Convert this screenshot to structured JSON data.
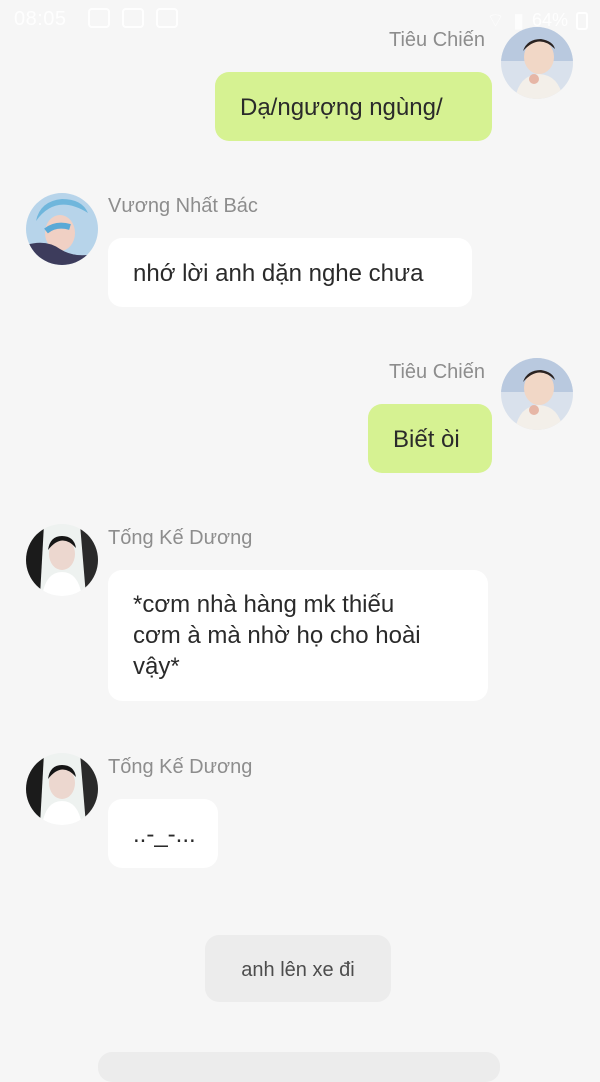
{
  "status_bar": {
    "time": "08:05",
    "battery": "64%"
  },
  "messages": [
    {
      "side": "right",
      "sender": "Tiêu Chiến",
      "text": "Dạ/ngượng ngùng/",
      "bubble_color": "#d6f292",
      "avatar": "avatar-tieu-chien"
    },
    {
      "side": "left",
      "sender": "Vương Nhất Bác",
      "text": "nhớ lời anh dặn nghe chưa",
      "bubble_color": "#ffffff",
      "avatar": "avatar-vuong-nhat-bac"
    },
    {
      "side": "right",
      "sender": "Tiêu Chiến",
      "text": "Biết òi",
      "bubble_color": "#d6f292",
      "avatar": "avatar-tieu-chien"
    },
    {
      "side": "left",
      "sender": "Tống Kế Dương",
      "text_lines": [
        "*cơm nhà hàng mk thiếu",
        "cơm à mà nhờ họ cho hoài",
        "vậy*"
      ],
      "bubble_color": "#ffffff",
      "avatar": "avatar-tong-ke-duong"
    },
    {
      "side": "left",
      "sender": "Tống Kế Dương",
      "text": "..-_-...",
      "bubble_color": "#ffffff",
      "avatar": "avatar-tong-ke-duong"
    }
  ],
  "system_note": {
    "text": "anh lên xe đi",
    "bubble_color": "#ececec"
  },
  "colors": {
    "background": "#f6f6f6",
    "name_gray": "#8d8d8d",
    "green_bubble": "#d6f292",
    "white_bubble": "#ffffff"
  }
}
